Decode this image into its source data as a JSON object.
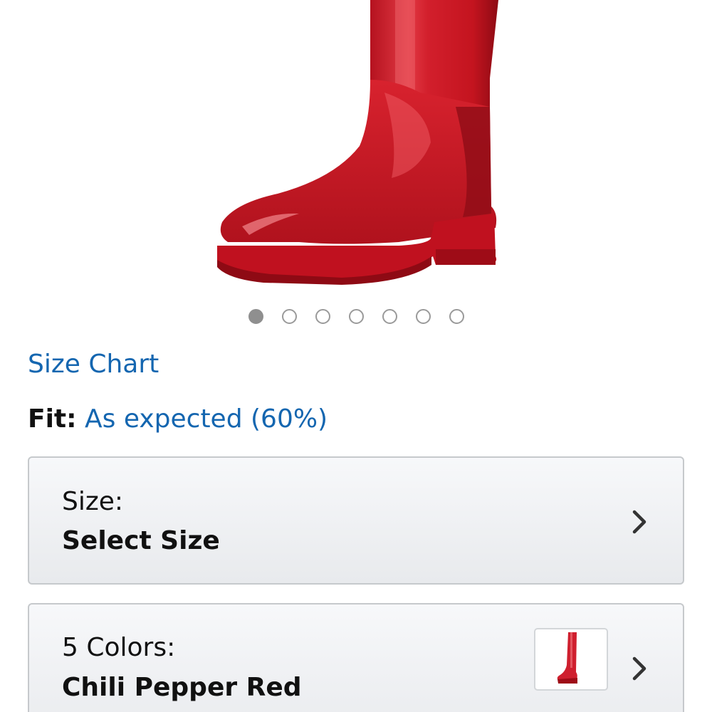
{
  "product": {
    "image_icon": "red-rain-boot-image",
    "image_count": 7,
    "active_image_index": 0,
    "accent_color": "#cf1f2e"
  },
  "links": {
    "size_chart": "Size Chart"
  },
  "fit": {
    "label": "Fit:",
    "value": "As expected (60%)"
  },
  "size_selector": {
    "label": "Size:",
    "value": "Select Size",
    "icon": "chevron-right-icon"
  },
  "color_selector": {
    "label": "5 Colors:",
    "value": "Chili Pepper Red",
    "swatch_icon": "red-boot-thumbnail",
    "icon": "chevron-right-icon"
  },
  "colors": {
    "link": "#1466b0",
    "text": "#111111",
    "border": "#c6c9cc"
  }
}
